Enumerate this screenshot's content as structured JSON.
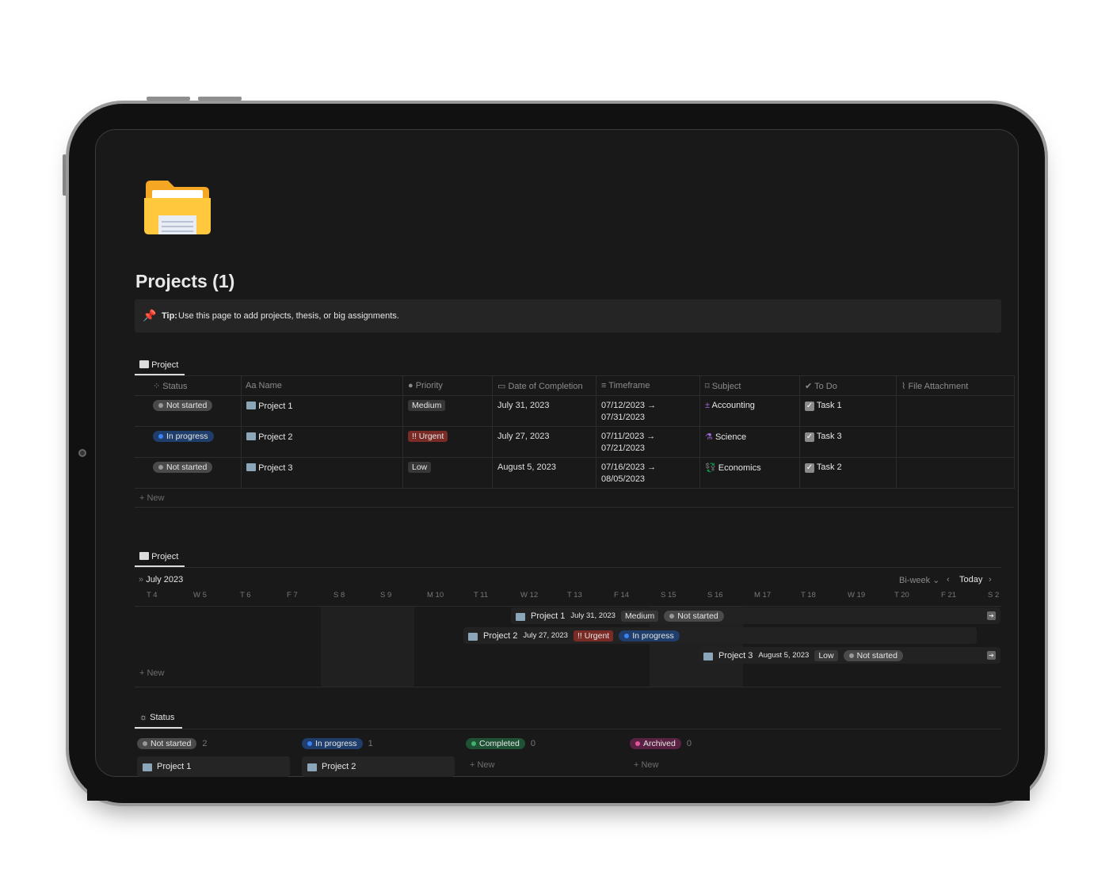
{
  "page": {
    "title": "Projects (1)",
    "tip_label": "Tip:",
    "tip_text": "Use this page to add projects, thesis, or big assignments."
  },
  "table_view": {
    "tab": "Project",
    "columns": [
      "Status",
      "Aa Name",
      "Priority",
      "Date of Completion",
      "Timeframe",
      "Subject",
      "To Do",
      "File Attachment"
    ],
    "rows": [
      {
        "status": "Not started",
        "name": "Project 1",
        "priority": "Medium",
        "date": "July 31, 2023",
        "tf1": "07/12/2023 →",
        "tf2": "07/31/2023",
        "subject": "Accounting",
        "todo": "Task 1"
      },
      {
        "status": "In progress",
        "name": "Project 2",
        "priority": "!! Urgent",
        "date": "July 27, 2023",
        "tf1": "07/11/2023 →",
        "tf2": "07/21/2023",
        "subject": "Science",
        "todo": "Task 3"
      },
      {
        "status": "Not started",
        "name": "Project 3",
        "priority": "Low",
        "date": "August 5, 2023",
        "tf1": "07/16/2023 →",
        "tf2": "08/05/2023",
        "subject": "Economics",
        "todo": "Task 2"
      }
    ],
    "new_label": "+ New"
  },
  "timeline_view": {
    "tab": "Project",
    "month": "July 2023",
    "scale": "Bi-week ⌄",
    "today": "Today",
    "days": [
      "T 4",
      "W 5",
      "T 6",
      "F 7",
      "S 8",
      "S 9",
      "M 10",
      "T 11",
      "W 12",
      "T 13",
      "F 14",
      "S 15",
      "S 16",
      "M 17",
      "T 18",
      "W 19",
      "T 20",
      "F 21",
      "S 2"
    ],
    "bars": [
      {
        "name": "Project 1",
        "date": "July 31, 2023",
        "priority": "Medium",
        "status": "Not started"
      },
      {
        "name": "Project 2",
        "date": "July 27, 2023",
        "priority": "!! Urgent",
        "status": "In progress"
      },
      {
        "name": "Project 3",
        "date": "August 5, 2023",
        "priority": "Low",
        "status": "Not started"
      }
    ],
    "new_label": "+ New"
  },
  "board_view": {
    "tab": "Status",
    "groups": [
      {
        "label": "Not started",
        "count": "2",
        "card": "Project 1"
      },
      {
        "label": "In progress",
        "count": "1",
        "card": "Project 2"
      },
      {
        "label": "Completed",
        "count": "0",
        "new": "+ New"
      },
      {
        "label": "Archived",
        "count": "0",
        "new": "+ New"
      }
    ]
  },
  "colors": {
    "background": "#191919",
    "not_started": "#4a4a4a",
    "in_progress": "#1f3e6b",
    "completed": "#1f5134",
    "archived": "#5a2242",
    "urgent": "#7a2b26",
    "subject_icon": "#9b6ad6"
  }
}
